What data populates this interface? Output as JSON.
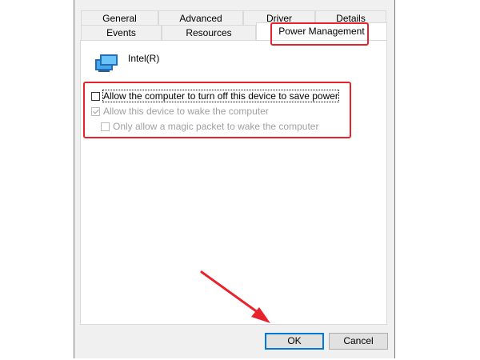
{
  "tabs_row1": [
    {
      "label": "General"
    },
    {
      "label": "Advanced"
    },
    {
      "label": "Driver"
    },
    {
      "label": "Details"
    }
  ],
  "tabs_row2": [
    {
      "label": "Events"
    },
    {
      "label": "Resources"
    },
    {
      "label": "Power Management",
      "active": true
    }
  ],
  "device": {
    "icon": "network-adapter-icon",
    "name": "Intel(R)"
  },
  "options": [
    {
      "label": "Allow the computer to turn off this device to save power",
      "checked": false,
      "enabled": true
    },
    {
      "label": "Allow this device to wake the computer",
      "checked": true,
      "enabled": false
    },
    {
      "label": "Only allow a magic packet to wake the computer",
      "checked": false,
      "enabled": false
    }
  ],
  "buttons": {
    "ok": "OK",
    "cancel": "Cancel"
  },
  "annotation": {
    "highlight_color": "#e8222a"
  }
}
